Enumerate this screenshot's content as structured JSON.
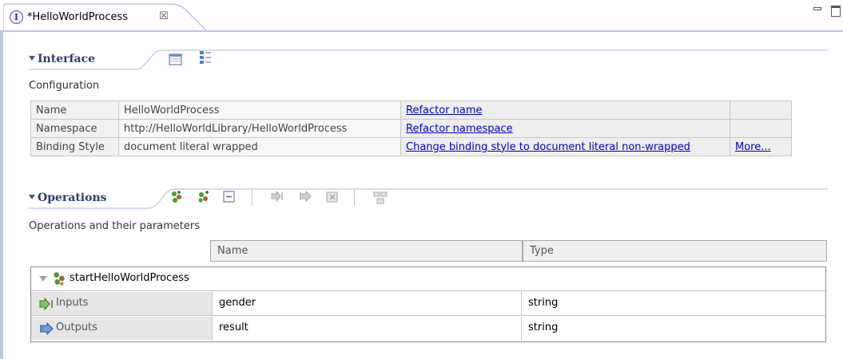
{
  "editor_tab": {
    "icon": "interface-icon",
    "icon_letter": "I",
    "title": "*HelloWorldProcess",
    "close_glyph": "☒"
  },
  "interface_section": {
    "title": "Interface",
    "description": "Configuration",
    "toolbar_icons": [
      "table-view-icon",
      "tree-view-icon"
    ],
    "rows": [
      {
        "label": "Name",
        "value": "HelloWorldProcess",
        "action": "Refactor name",
        "extra": ""
      },
      {
        "label": "Namespace",
        "value": "http://HelloWorldLibrary/HelloWorldProcess",
        "action": "Refactor namespace",
        "extra": ""
      },
      {
        "label": "Binding Style",
        "value": "document literal wrapped",
        "action": "Change binding style to document literal non-wrapped",
        "extra": "More..."
      }
    ]
  },
  "operations_section": {
    "title": "Operations",
    "description": "Operations and their parameters",
    "toolbar_icons": [
      "add-request-response-operation-icon",
      "add-one-way-operation-icon",
      "add-fault-icon",
      "add-input-icon",
      "add-output-icon",
      "delete-icon",
      "show-in-graphical-view-icon"
    ],
    "columns": [
      "Name",
      "Type"
    ],
    "operation": {
      "name": "startHelloWorldProcess",
      "icon": "operation-icon"
    },
    "params": [
      {
        "kind": "Inputs",
        "icon": "input-arrow-icon",
        "name": "gender",
        "type": "string"
      },
      {
        "kind": "Outputs",
        "icon": "output-arrow-icon",
        "name": "result",
        "type": "string"
      }
    ]
  },
  "colors": {
    "link": "#0000cc",
    "section_title": "#2c3e6b",
    "tab_border": "#b8c9e2",
    "label_cell_bg": "#e6e6e6",
    "icon_green": "#4c9a2a",
    "icon_brown": "#9b6b2f"
  }
}
